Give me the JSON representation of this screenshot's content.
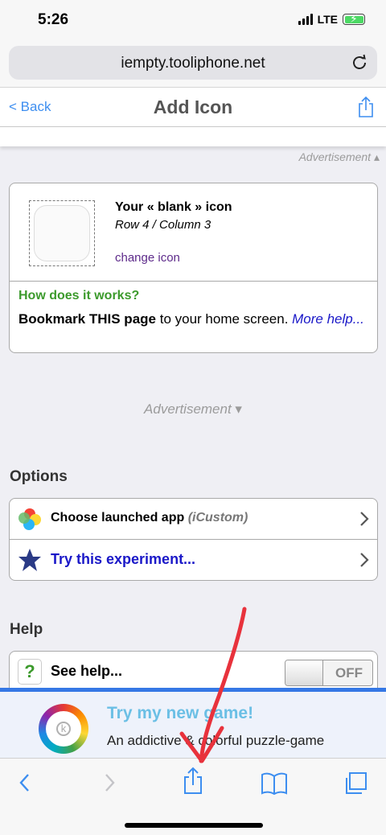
{
  "status": {
    "time": "5:26",
    "network": "LTE"
  },
  "browser": {
    "url": "iempty.tooliphone.net"
  },
  "nav": {
    "back_label": "< Back",
    "title": "Add Icon"
  },
  "ads": {
    "top": "Advertisement ▴",
    "middle": "Advertisement ▾"
  },
  "icon_card": {
    "title": "Your « blank » icon",
    "position": "Row 4 / Column 3",
    "change_link": "change icon",
    "how_title": "How does it works?",
    "instruction_bold": "Bookmark THIS page",
    "instruction_rest": " to your home screen. ",
    "more_help": "More help..."
  },
  "options": {
    "heading": "Options",
    "items": [
      {
        "label": "Choose launched app",
        "sub": "(iCustom)"
      },
      {
        "label": "Try this experiment..."
      }
    ]
  },
  "help": {
    "heading": "Help",
    "see_help": "See help...",
    "toggle_state": "OFF"
  },
  "promo": {
    "title": "Try my new game!",
    "subtitle": "An addictive & colorful puzzle-game"
  },
  "colors": {
    "accent": "#3578e5",
    "ios_blue": "#3d8ef0",
    "green": "#3c9a2c",
    "annotation_red": "#e8323c"
  }
}
